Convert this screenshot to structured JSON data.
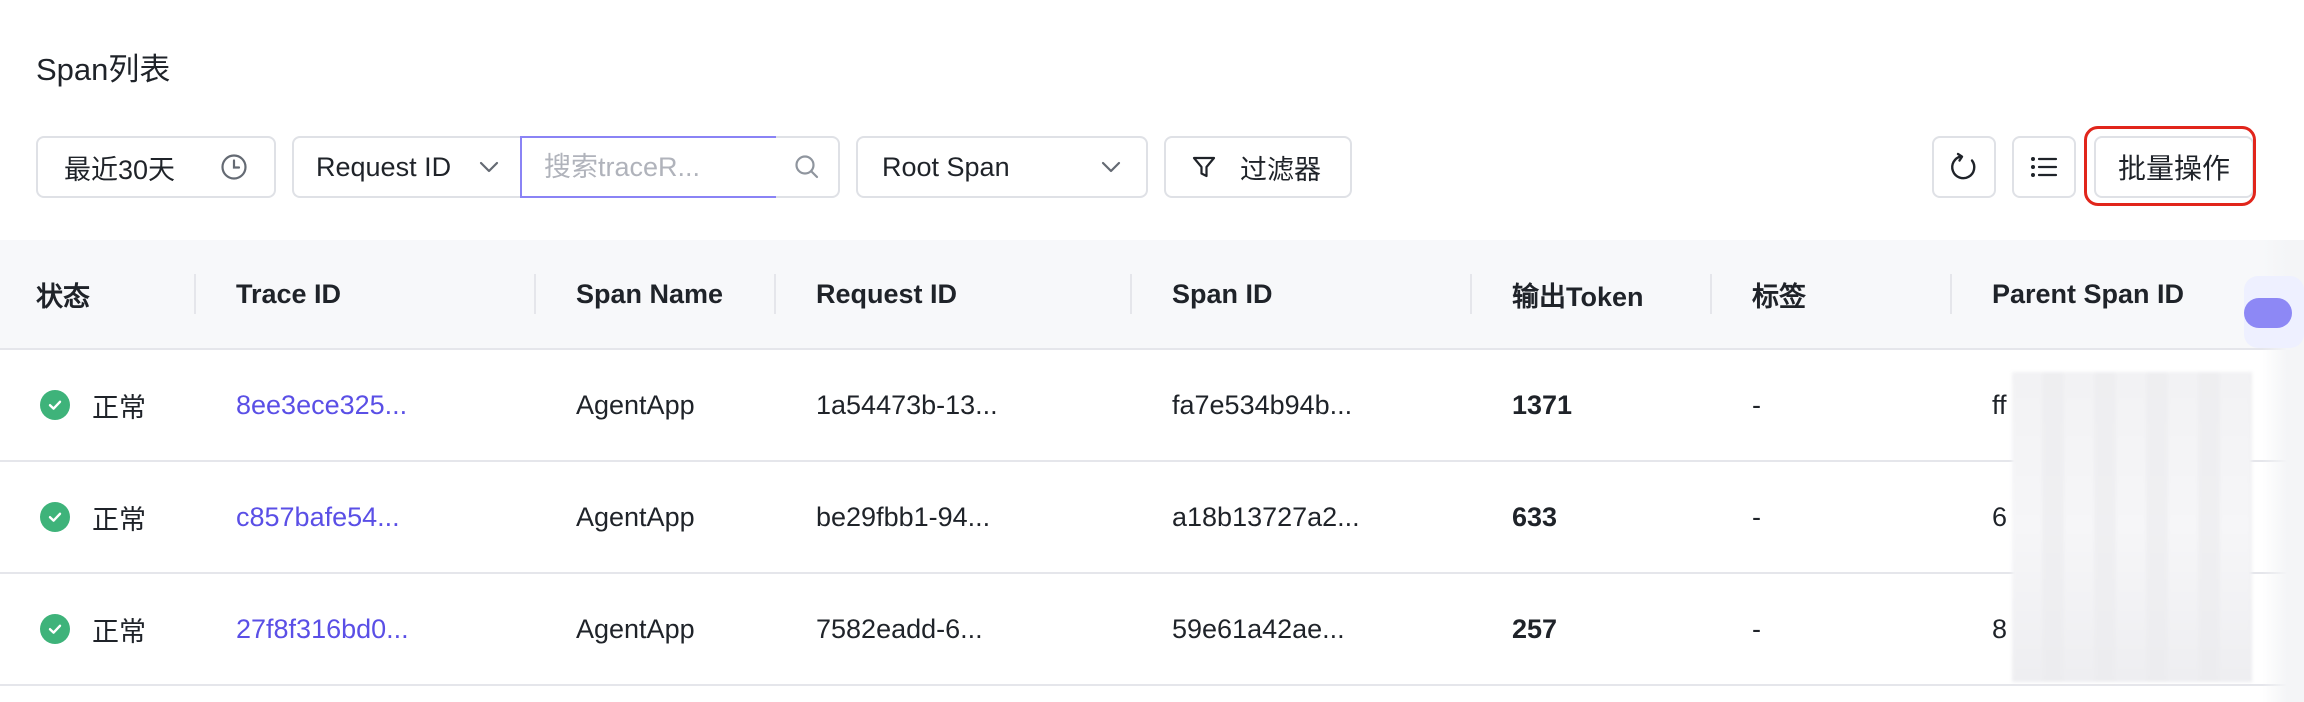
{
  "page_title": "Span列表",
  "toolbar": {
    "date_range": "最近30天",
    "id_type": "Request ID",
    "search_placeholder": "搜索traceR...",
    "span_type": "Root Span",
    "filter_label": "过滤器",
    "batch_label": "批量操作"
  },
  "table": {
    "headers": {
      "status": "状态",
      "trace_id": "Trace ID",
      "span_name": "Span Name",
      "request_id": "Request ID",
      "span_id": "Span ID",
      "output_token": "输出Token",
      "tags": "标签",
      "parent_span_id": "Parent Span ID"
    },
    "rows": [
      {
        "status": "正常",
        "trace_id": "8ee3ece325...",
        "span_name": "AgentApp",
        "request_id": "1a54473b-13...",
        "span_id": "fa7e534b94b...",
        "output_token": "1371",
        "tags": "-",
        "parent_span_id": "ff"
      },
      {
        "status": "正常",
        "trace_id": "c857bafe54...",
        "span_name": "AgentApp",
        "request_id": "be29fbb1-94...",
        "span_id": "a18b13727a2...",
        "output_token": "633",
        "tags": "-",
        "parent_span_id": "6"
      },
      {
        "status": "正常",
        "trace_id": "27f8f316bd0...",
        "span_name": "AgentApp",
        "request_id": "7582eadd-6...",
        "span_id": "59e61a42ae...",
        "output_token": "257",
        "tags": "-",
        "parent_span_id": "8"
      }
    ]
  },
  "icons": {
    "date": "clock-icon",
    "dropdown": "chevron-down-icon",
    "search": "search-icon",
    "filter": "funnel-icon",
    "refresh": "refresh-icon",
    "columns": "list-icon",
    "status_ok": "check-circle-icon"
  },
  "colors": {
    "link": "#5a4fe6",
    "accent_border": "#8a83f5",
    "status_ok": "#3eb37a",
    "highlight": "#e1251b"
  }
}
